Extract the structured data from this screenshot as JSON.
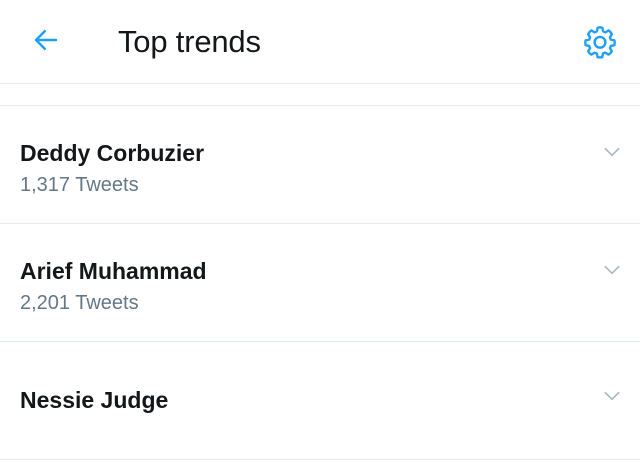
{
  "header": {
    "title": "Top trends",
    "back_icon": "arrow-left-icon",
    "settings_icon": "gear-icon"
  },
  "colors": {
    "accent": "#1da1f2",
    "text_primary": "#14171a",
    "text_secondary": "#657786",
    "divider": "#e6ecf0",
    "chevron": "#aab8c2"
  },
  "trends": [
    {
      "name": "Deddy Corbuzier",
      "count": "1,317 Tweets",
      "icon": "chevron-down-icon"
    },
    {
      "name": "Arief Muhammad",
      "count": "2,201 Tweets",
      "icon": "chevron-down-icon"
    },
    {
      "name": "Nessie Judge",
      "icon": "chevron-down-icon"
    }
  ]
}
